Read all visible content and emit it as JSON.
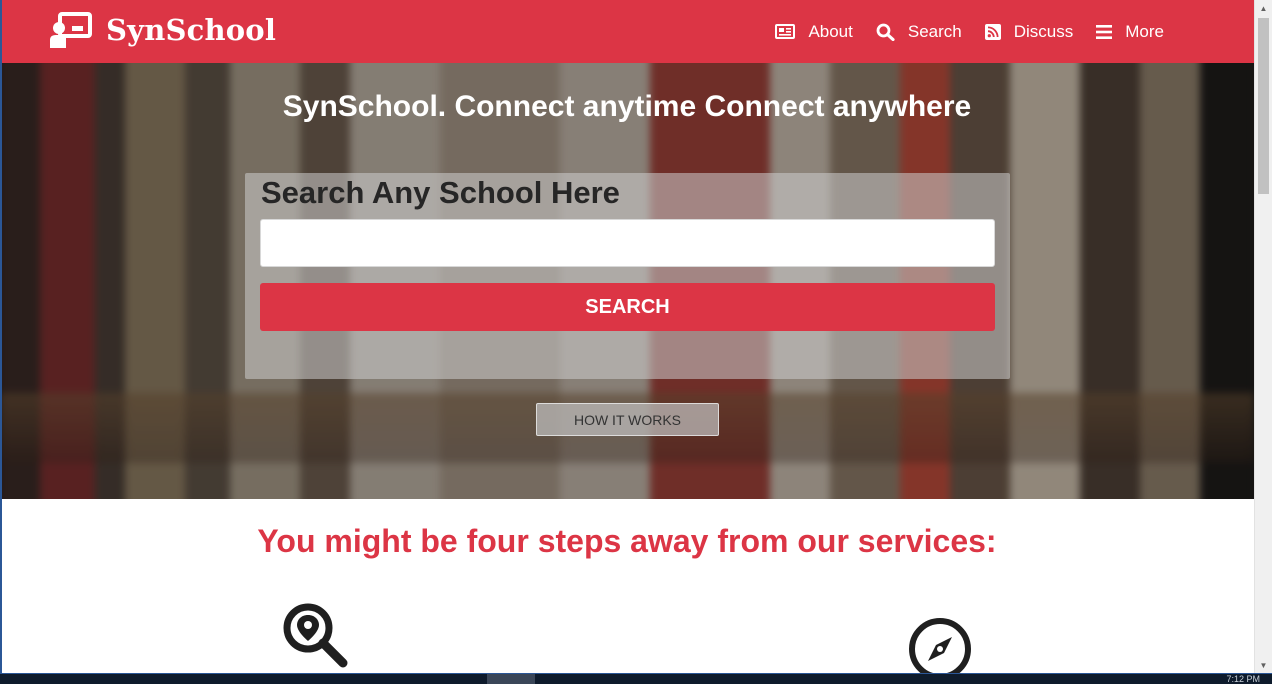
{
  "brand": {
    "name": "SynSchool",
    "color": "#dc3545"
  },
  "nav": {
    "items": [
      {
        "label": "About",
        "icon": "id-card-icon"
      },
      {
        "label": "Search",
        "icon": "search-icon"
      },
      {
        "label": "Discuss",
        "icon": "rss-icon"
      },
      {
        "label": "More",
        "icon": "menu-icon"
      }
    ]
  },
  "hero": {
    "title": "SynSchool. Connect anytime Connect anywhere",
    "search": {
      "heading": "Search Any School Here",
      "input_value": "",
      "button_label": "SEARCH"
    },
    "how_it_works_label": "HOW IT WORKS"
  },
  "steps": {
    "title": "You might be four steps away from our services:",
    "icons": [
      "location-search-icon",
      "compass-icon"
    ]
  },
  "taskbar": {
    "clock": "7:12 PM"
  }
}
